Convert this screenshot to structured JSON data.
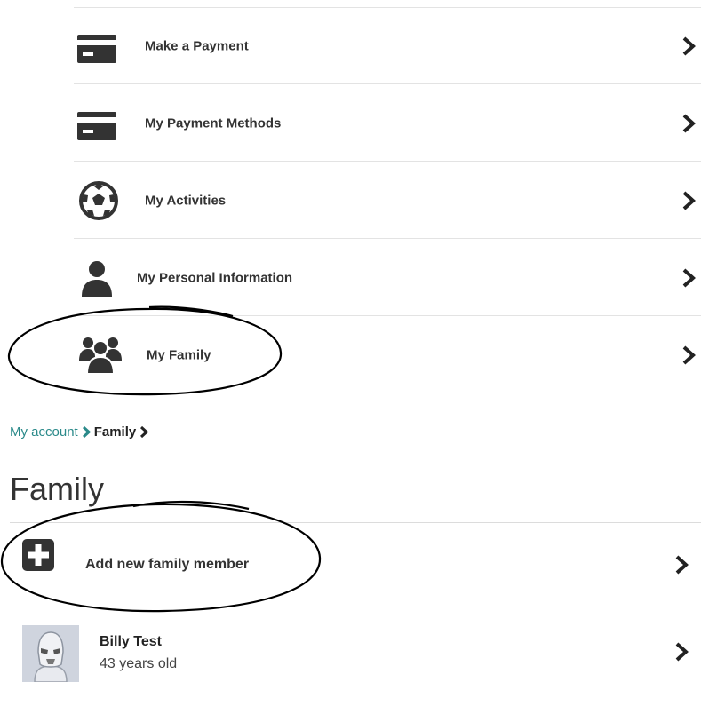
{
  "menu": {
    "items": [
      {
        "label": "Make a Payment",
        "icon": "card-icon"
      },
      {
        "label": "My Payment Methods",
        "icon": "card-icon"
      },
      {
        "label": "My Activities",
        "icon": "soccer-ball-icon"
      },
      {
        "label": "My Personal Information",
        "icon": "user-icon"
      },
      {
        "label": "My Family",
        "icon": "group-icon"
      }
    ]
  },
  "breadcrumb": {
    "root": "My account",
    "current": "Family"
  },
  "page": {
    "title": "Family"
  },
  "family": {
    "add_label": "Add new family member",
    "members": [
      {
        "name": "Billy Test",
        "age": "43 years old"
      }
    ]
  },
  "colors": {
    "link": "#2b8a8a",
    "icon": "#333333",
    "annotation": "#000000"
  }
}
